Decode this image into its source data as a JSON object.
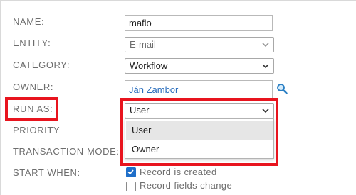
{
  "form": {
    "name": {
      "label": "NAME:",
      "value": "maflo"
    },
    "entity": {
      "label": "ENTITY:",
      "value": "E-mail"
    },
    "category": {
      "label": "CATEGORY:",
      "value": "Workflow"
    },
    "owner": {
      "label": "OWNER:",
      "value": "Ján Zambor"
    },
    "run_as": {
      "label": "RUN AS:",
      "value": "User",
      "options": [
        "User",
        "Owner"
      ],
      "highlighted_option": "User"
    },
    "priority": {
      "label": "PRIORITY"
    },
    "transaction_mode": {
      "label": "TRANSACTION MODE:"
    },
    "start_when": {
      "label": "START WHEN:",
      "options": [
        {
          "label": "Record is created",
          "checked": true
        },
        {
          "label": "Record fields change",
          "checked": false
        }
      ]
    }
  },
  "icons": {
    "owner_lookup": "magnifier-icon",
    "dropdown_arrow": "chevron-down-icon"
  },
  "colors": {
    "highlight_box": "#e8141e",
    "link": "#2a6ebd",
    "checkbox_checked": "#1f6fc9"
  }
}
